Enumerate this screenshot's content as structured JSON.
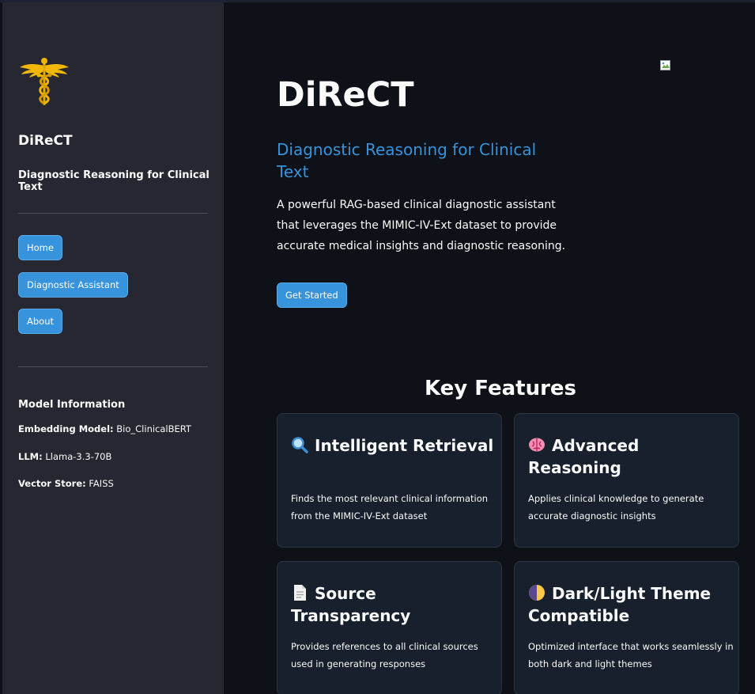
{
  "sidebar": {
    "title": "DiReCT",
    "subtitle": "Diagnostic Reasoning for Clinical Text",
    "logo_icon": "caduceus-icon",
    "nav": [
      {
        "label": "Home"
      },
      {
        "label": "Diagnostic Assistant"
      },
      {
        "label": "About"
      }
    ],
    "model_info": {
      "heading": "Model Information",
      "embedding_label": "Embedding Model:",
      "embedding_value": "Bio_ClinicalBERT",
      "llm_label": "LLM:",
      "llm_value": "Llama-3.3-70B",
      "vector_label": "Vector Store:",
      "vector_value": "FAISS"
    }
  },
  "hero": {
    "title": "DiReCT",
    "tagline": "Diagnostic Reasoning for Clinical Text",
    "description": "A powerful RAG-based clinical diagnostic assistant that leverages the MIMIC-IV-Ext dataset to provide accurate medical insights and diagnostic reasoning.",
    "cta_label": "Get Started"
  },
  "features": {
    "heading": "Key Features",
    "cards": [
      {
        "icon": "magnifier-icon",
        "title": "Intelligent Retrieval",
        "description": "Finds the most relevant clinical information from the MIMIC-IV-Ext dataset"
      },
      {
        "icon": "brain-icon",
        "title": "Advanced Reasoning",
        "description": "Applies clinical knowledge to generate accurate diagnostic insights"
      },
      {
        "icon": "document-icon",
        "title": "Source Transparency",
        "description": "Provides references to all clinical sources used in generating responses"
      },
      {
        "icon": "half-moon-icon",
        "title": "Dark/Light Theme Compatible",
        "description": "Optimized interface that works seamlessly in both dark and light themes"
      }
    ]
  },
  "colors": {
    "accent": "#3793db",
    "background": "#0e1117",
    "sidebar": "#262730",
    "card": "#17202c",
    "logo_gold": "#f2b705"
  }
}
